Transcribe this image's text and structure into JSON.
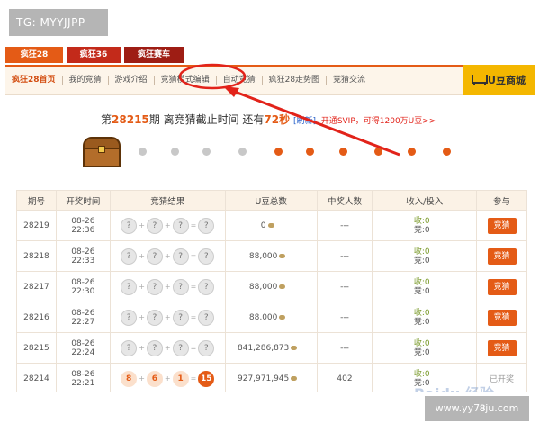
{
  "overlays": {
    "top_left_tag": "TG: MYYJJPP",
    "bottom_right_tag": "www.yy7𝟖ju.com"
  },
  "tabs": [
    "疯狂28",
    "疯狂36",
    "疯狂赛车"
  ],
  "nav": {
    "items": [
      "疯狂28首页",
      "我的竞猜",
      "游戏介绍",
      "竞猜模式编辑",
      "自动竞猜",
      "疯狂28走势图",
      "竞猜交流"
    ],
    "mall_label": "U豆商城"
  },
  "headline": {
    "prefix": "第",
    "period": "28215",
    "mid": "期 离竞猜截止时间 还有",
    "seconds": "72",
    "unit": "秒",
    "refresh": "[刷新]",
    "promo": "开通SVIP，可得1200万U豆>>"
  },
  "colors": {
    "accent": "#e45b16",
    "highlight": "#e2231a",
    "mall": "#f4b700"
  },
  "table": {
    "headers": [
      "期号",
      "开奖时间",
      "竞猜结果",
      "U豆总数",
      "中奖人数",
      "收入/投入",
      "参与"
    ],
    "rows": [
      {
        "period": "28219",
        "date": "08-26",
        "time": "22:36",
        "balls": [
          "?",
          "?",
          "?",
          "?"
        ],
        "pool": "0",
        "winners": "---",
        "inc": "收:0",
        "out": "竞:0",
        "action": "竞猜"
      },
      {
        "period": "28218",
        "date": "08-26",
        "time": "22:33",
        "balls": [
          "?",
          "?",
          "?",
          "?"
        ],
        "pool": "88,000",
        "winners": "---",
        "inc": "收:0",
        "out": "竞:0",
        "action": "竞猜"
      },
      {
        "period": "28217",
        "date": "08-26",
        "time": "22:30",
        "balls": [
          "?",
          "?",
          "?",
          "?"
        ],
        "pool": "88,000",
        "winners": "---",
        "inc": "收:0",
        "out": "竞:0",
        "action": "竞猜"
      },
      {
        "period": "28216",
        "date": "08-26",
        "time": "22:27",
        "balls": [
          "?",
          "?",
          "?",
          "?"
        ],
        "pool": "88,000",
        "winners": "---",
        "inc": "收:0",
        "out": "竞:0",
        "action": "竞猜"
      },
      {
        "period": "28215",
        "date": "08-26",
        "time": "22:24",
        "balls": [
          "?",
          "?",
          "?",
          "?"
        ],
        "pool": "841,286,873",
        "winners": "---",
        "inc": "收:0",
        "out": "竞:0",
        "action": "竞猜"
      },
      {
        "period": "28214",
        "date": "08-26",
        "time": "22:21",
        "balls": [
          "8",
          "6",
          "1",
          "15"
        ],
        "pool": "927,971,945",
        "winners": "402",
        "inc": "收:0",
        "out": "竞:0",
        "action": "已开奖"
      }
    ]
  },
  "watermark": "Baidu 经验"
}
